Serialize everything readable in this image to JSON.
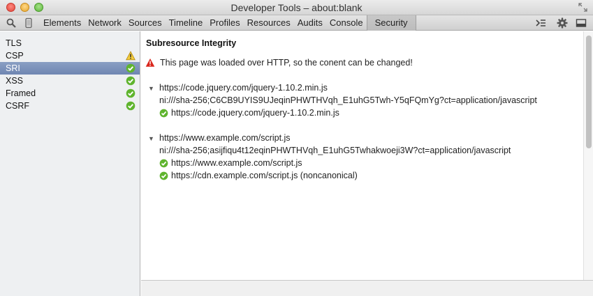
{
  "window": {
    "title": "Developer Tools – about:blank"
  },
  "toolbar": {
    "tabs": [
      {
        "label": "Elements"
      },
      {
        "label": "Network"
      },
      {
        "label": "Sources"
      },
      {
        "label": "Timeline"
      },
      {
        "label": "Profiles"
      },
      {
        "label": "Resources"
      },
      {
        "label": "Audits"
      },
      {
        "label": "Console"
      },
      {
        "label": "Security",
        "selected": true
      }
    ],
    "icons": [
      "search-icon",
      "device-icon",
      "console-drawer-icon",
      "gear-icon",
      "dock-icon"
    ]
  },
  "sidebar": {
    "items": [
      {
        "label": "TLS",
        "status": "none"
      },
      {
        "label": "CSP",
        "status": "warning"
      },
      {
        "label": "SRI",
        "status": "ok",
        "selected": true
      },
      {
        "label": "XSS",
        "status": "ok"
      },
      {
        "label": "Framed",
        "status": "ok"
      },
      {
        "label": "CSRF",
        "status": "ok"
      }
    ]
  },
  "main": {
    "title": "Subresource Integrity",
    "warning": "This page was loaded over HTTP, so the conent can be changed!",
    "resources": [
      {
        "url": "https://code.jquery.com/jquery-1.10.2.min.js",
        "integrity": "ni:///sha-256;C6CB9UYIS9UJeqinPHWTHVqh_E1uhG5Twh-Y5qFQmYg?ct=application/javascript",
        "verified": [
          "https://code.jquery.com/jquery-1.10.2.min.js"
        ]
      },
      {
        "url": "https://www.example.com/script.js",
        "integrity": "ni:///sha-256;asijfiqu4t12eqinPHWTHVqh_E1uhG5Twhakwoeji3W?ct=application/javascript",
        "verified": [
          "https://www.example.com/script.js",
          "https://cdn.example.com/script.js (noncanonical)"
        ]
      }
    ]
  },
  "colors": {
    "selected_row": "#7b90bb",
    "ok": "#5fb42e",
    "warning": "#e8b823",
    "error": "#d9261c"
  }
}
